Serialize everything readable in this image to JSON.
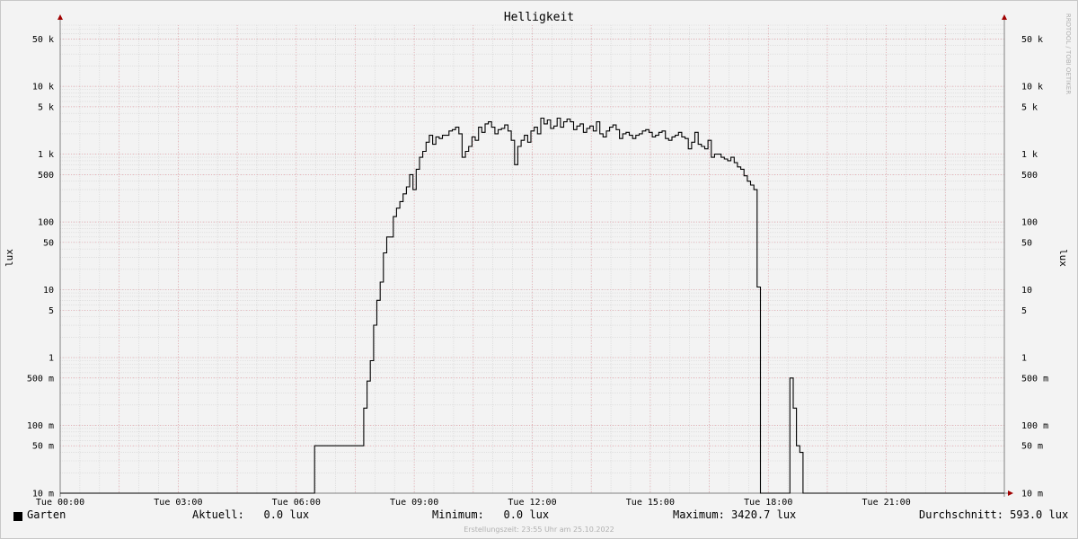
{
  "chart_data": {
    "type": "line",
    "title": "Helligkeit",
    "ylabel": "lux",
    "yscale": "log",
    "ylim": [
      0.01,
      80000
    ],
    "y_ticks": [
      {
        "value": 50000,
        "label": "50 k"
      },
      {
        "value": 10000,
        "label": "10 k"
      },
      {
        "value": 5000,
        "label": "5 k"
      },
      {
        "value": 1000,
        "label": "1 k"
      },
      {
        "value": 500,
        "label": "500"
      },
      {
        "value": 100,
        "label": "100"
      },
      {
        "value": 50,
        "label": "50"
      },
      {
        "value": 10,
        "label": "10"
      },
      {
        "value": 5,
        "label": "5"
      },
      {
        "value": 1,
        "label": "1"
      },
      {
        "value": 0.5,
        "label": "500 m"
      },
      {
        "value": 0.1,
        "label": "100 m"
      },
      {
        "value": 0.05,
        "label": "50 m"
      },
      {
        "value": 0.01,
        "label": "10 m"
      }
    ],
    "xlim": [
      "00:00",
      "24:00"
    ],
    "x_ticks": [
      "Tue 00:00",
      "Tue 03:00",
      "Tue 06:00",
      "Tue 09:00",
      "Tue 12:00",
      "Tue 15:00",
      "Tue 18:00",
      "Tue 21:00"
    ],
    "grid": true,
    "series": [
      {
        "name": "Garten",
        "color": "#000000",
        "step": true,
        "points": [
          [
            "00:00",
            0.01
          ],
          [
            "06:28",
            0.01
          ],
          [
            "06:28",
            0.05
          ],
          [
            "07:38",
            0.05
          ],
          [
            "07:43",
            0.18
          ],
          [
            "07:48",
            0.45
          ],
          [
            "07:53",
            0.9
          ],
          [
            "07:58",
            3
          ],
          [
            "08:03",
            7
          ],
          [
            "08:08",
            13
          ],
          [
            "08:13",
            35
          ],
          [
            "08:18",
            60
          ],
          [
            "08:23",
            60
          ],
          [
            "08:28",
            120
          ],
          [
            "08:33",
            160
          ],
          [
            "08:38",
            200
          ],
          [
            "08:43",
            260
          ],
          [
            "08:48",
            330
          ],
          [
            "08:53",
            500
          ],
          [
            "08:58",
            300
          ],
          [
            "09:03",
            600
          ],
          [
            "09:08",
            900
          ],
          [
            "09:13",
            1100
          ],
          [
            "09:18",
            1500
          ],
          [
            "09:23",
            1900
          ],
          [
            "09:28",
            1400
          ],
          [
            "09:33",
            1800
          ],
          [
            "09:38",
            1700
          ],
          [
            "09:43",
            1900
          ],
          [
            "09:48",
            1900
          ],
          [
            "09:53",
            2200
          ],
          [
            "09:58",
            2300
          ],
          [
            "10:03",
            2500
          ],
          [
            "10:08",
            2000
          ],
          [
            "10:13",
            900
          ],
          [
            "10:18",
            1100
          ],
          [
            "10:23",
            1300
          ],
          [
            "10:28",
            1800
          ],
          [
            "10:33",
            1600
          ],
          [
            "10:38",
            2500
          ],
          [
            "10:43",
            2100
          ],
          [
            "10:48",
            2800
          ],
          [
            "10:53",
            3000
          ],
          [
            "10:58",
            2500
          ],
          [
            "11:03",
            2000
          ],
          [
            "11:08",
            2300
          ],
          [
            "11:13",
            2400
          ],
          [
            "11:18",
            2700
          ],
          [
            "11:23",
            2200
          ],
          [
            "11:28",
            1600
          ],
          [
            "11:33",
            700
          ],
          [
            "11:38",
            1300
          ],
          [
            "11:43",
            1600
          ],
          [
            "11:48",
            1900
          ],
          [
            "11:53",
            1500
          ],
          [
            "11:58",
            2200
          ],
          [
            "12:03",
            2500
          ],
          [
            "12:08",
            2000
          ],
          [
            "12:13",
            3400
          ],
          [
            "12:18",
            2800
          ],
          [
            "12:23",
            3200
          ],
          [
            "12:28",
            2400
          ],
          [
            "12:33",
            2600
          ],
          [
            "12:38",
            3400
          ],
          [
            "12:43",
            2500
          ],
          [
            "12:48",
            3000
          ],
          [
            "12:53",
            3300
          ],
          [
            "12:58",
            3000
          ],
          [
            "13:03",
            2300
          ],
          [
            "13:08",
            2600
          ],
          [
            "13:13",
            2800
          ],
          [
            "13:18",
            2100
          ],
          [
            "13:23",
            2400
          ],
          [
            "13:28",
            2600
          ],
          [
            "13:33",
            2200
          ],
          [
            "13:38",
            3000
          ],
          [
            "13:43",
            2000
          ],
          [
            "13:48",
            1800
          ],
          [
            "13:53",
            2200
          ],
          [
            "13:58",
            2500
          ],
          [
            "14:03",
            2700
          ],
          [
            "14:08",
            2300
          ],
          [
            "14:13",
            1700
          ],
          [
            "14:18",
            2000
          ],
          [
            "14:23",
            2100
          ],
          [
            "14:28",
            1900
          ],
          [
            "14:33",
            1700
          ],
          [
            "14:38",
            1900
          ],
          [
            "14:43",
            2000
          ],
          [
            "14:48",
            2200
          ],
          [
            "14:53",
            2300
          ],
          [
            "14:58",
            2100
          ],
          [
            "15:03",
            1800
          ],
          [
            "15:08",
            1900
          ],
          [
            "15:13",
            2100
          ],
          [
            "15:18",
            2200
          ],
          [
            "15:23",
            1700
          ],
          [
            "15:28",
            1600
          ],
          [
            "15:33",
            1800
          ],
          [
            "15:38",
            1900
          ],
          [
            "15:43",
            2100
          ],
          [
            "15:48",
            1800
          ],
          [
            "15:53",
            1700
          ],
          [
            "15:58",
            1200
          ],
          [
            "16:03",
            1500
          ],
          [
            "16:08",
            2100
          ],
          [
            "16:13",
            1400
          ],
          [
            "16:18",
            1300
          ],
          [
            "16:23",
            1200
          ],
          [
            "16:28",
            1600
          ],
          [
            "16:33",
            900
          ],
          [
            "16:38",
            1000
          ],
          [
            "16:43",
            1000
          ],
          [
            "16:48",
            900
          ],
          [
            "16:53",
            850
          ],
          [
            "16:58",
            800
          ],
          [
            "17:03",
            900
          ],
          [
            "17:08",
            750
          ],
          [
            "17:13",
            650
          ],
          [
            "17:18",
            600
          ],
          [
            "17:23",
            480
          ],
          [
            "17:28",
            400
          ],
          [
            "17:33",
            350
          ],
          [
            "17:38",
            300
          ],
          [
            "17:43",
            11
          ],
          [
            "17:48",
            0.01
          ],
          [
            "18:33",
            0.01
          ],
          [
            "18:33",
            0.5
          ],
          [
            "18:38",
            0.18
          ],
          [
            "18:43",
            0.05
          ],
          [
            "18:48",
            0.04
          ],
          [
            "18:53",
            0.01
          ],
          [
            "24:00",
            0.01
          ]
        ]
      }
    ]
  },
  "legend": {
    "series_name": "Garten",
    "current": "Aktuell:   0.0 lux",
    "minimum": "Minimum:   0.0 lux",
    "maximum": "Maximum: 3420.7 lux",
    "average": "Durchschnitt: 593.0 lux"
  },
  "footer": "Erstellungszeit: 23:55 Uhr am 25.10.2022",
  "watermark": "RRDTOOL / TOBI OETIKER"
}
